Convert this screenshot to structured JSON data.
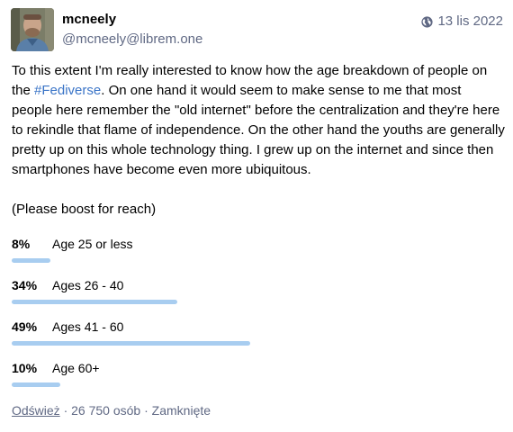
{
  "author": {
    "display_name": "mcneely",
    "acct": "@mcneely@librem.one"
  },
  "timestamp": {
    "icon": "globe-icon",
    "text": "13 lis 2022"
  },
  "content": {
    "paragraph1_before": "To this extent I'm really interested to know how the age breakdown of people on the ",
    "hashtag": "#Fediverse",
    "paragraph1_after": ". On one hand it would seem to make sense to me that most people here remember the \"old internet\" before the centralization and they're here to rekindle that flame of independence. On the other hand the youths are generally pretty up on this whole technology thing. I grew up on the internet and since then smartphones have become even more ubiquitous.",
    "paragraph2": "(Please boost for reach)"
  },
  "poll": {
    "options": [
      {
        "percent_label": "8%",
        "percent": 8,
        "label": "Age 25 or less"
      },
      {
        "percent_label": "34%",
        "percent": 34,
        "label": "Ages 26 - 40"
      },
      {
        "percent_label": "49%",
        "percent": 49,
        "label": "Ages 41 - 60"
      },
      {
        "percent_label": "10%",
        "percent": 10,
        "label": "Age 60+"
      }
    ],
    "footer": {
      "refresh_label": "Odśwież",
      "voters": "26 750 osób",
      "status": "Zamknięte",
      "separator": " · "
    },
    "bar_color": "#a8cdf0"
  },
  "colors": {
    "link": "#3a74c7",
    "muted": "#606984"
  }
}
